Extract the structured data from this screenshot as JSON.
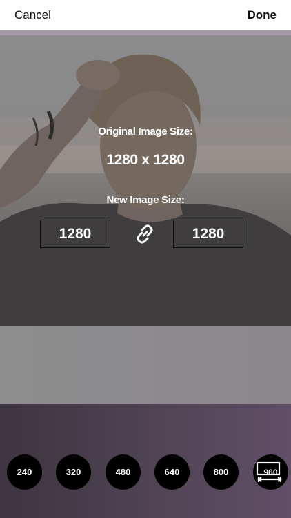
{
  "nav": {
    "cancel_label": "Cancel",
    "done_label": "Done"
  },
  "resize": {
    "original_label": "Original Image Size:",
    "original_value": "1280 x 1280",
    "new_label": "New Image Size:",
    "width_value": "1280",
    "height_value": "1280"
  },
  "presets": [
    {
      "label": "240"
    },
    {
      "label": "320"
    },
    {
      "label": "480"
    },
    {
      "label": "640"
    },
    {
      "label": "800"
    }
  ],
  "custom_preset": {
    "label": "960",
    "icon": "resize-icon"
  },
  "icons": {
    "link": "link-icon"
  },
  "colors": {
    "nav_background": "#ffffff",
    "preset_button": "#000000",
    "text_on_photo": "#ffffff",
    "tray_gradient_start": "#3d3540",
    "tray_gradient_end": "#614f67"
  }
}
